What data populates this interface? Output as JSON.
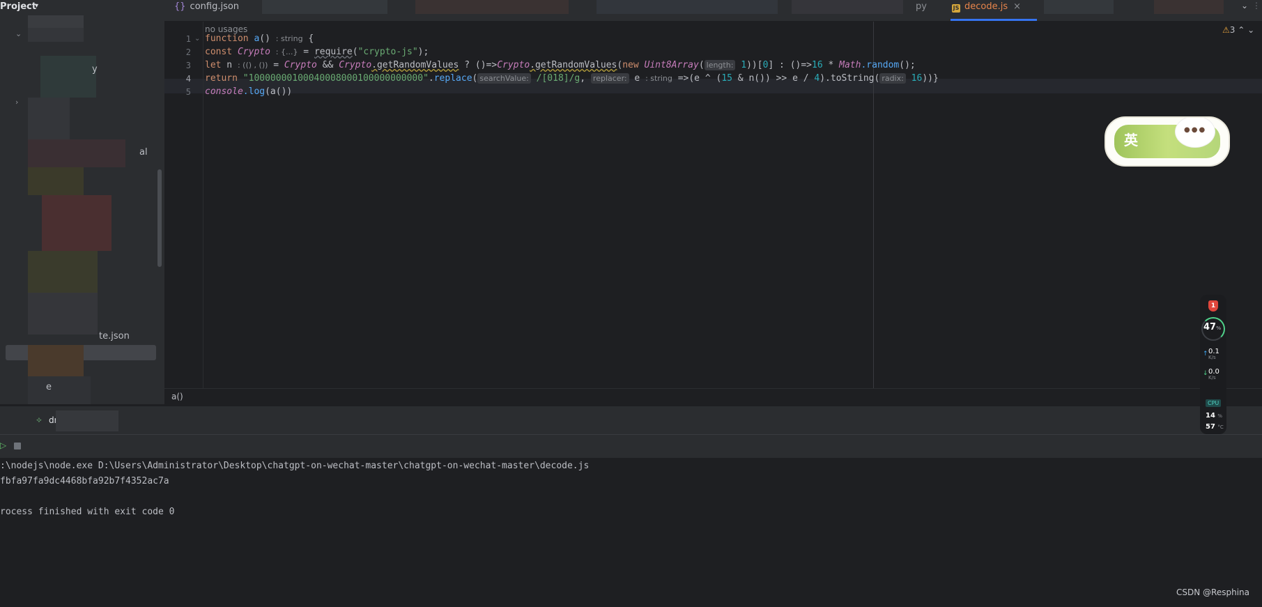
{
  "sidebar": {
    "title": "Project",
    "visible_fragments": [
      "y",
      "al",
      "te.json",
      "e",
      "dr"
    ]
  },
  "tabs": {
    "items": [
      {
        "label": "config.json",
        "icon": "json-file-icon"
      },
      {
        "label": "py",
        "icon": "python-file-icon"
      },
      {
        "label": "decode.js",
        "icon": "js-file-icon",
        "active": true
      }
    ],
    "close_glyph": "×"
  },
  "editor": {
    "no_usages": "no usages",
    "warnings_count": "3",
    "line_numbers": [
      "1",
      "2",
      "3",
      "4",
      "5"
    ],
    "breadcrumb": "a()",
    "line1": {
      "kw": "function",
      "name": "a",
      "parens": "()",
      "hint": ": string",
      "brace": "{"
    },
    "line2": {
      "kw": "const",
      "var": "Crypto",
      "hint": ": {...}",
      "eq": " = ",
      "fn": "require",
      "open": "(",
      "str": "\"crypto-js\"",
      "close": ");"
    },
    "line3": {
      "kw": "let",
      "var": " n",
      "hint": ": (() , ())",
      "eq": " = ",
      "c1": "Crypto",
      "and": " && ",
      "c2": "Crypto",
      "m1": ".getRandomValues",
      "tern": " ? ()=>",
      "c3": "Crypto",
      "m2": ".getRandomValues",
      "p1": "(",
      "kw2": "new ",
      "cls": "Uint8Array",
      "p2": "(",
      "hint_len": "length:",
      "n1": "1",
      "p3": "))[",
      "n0": "0",
      "p4": "] : ()=>",
      "n16": "16",
      "mul": " * ",
      "math": "Math",
      "rand": ".random",
      "end": "();"
    },
    "line4": {
      "kw": "return",
      "str": "\"10000000100040008000100000000000\"",
      "dot": ".",
      "fn": "replace",
      "p1": "(",
      "hint_sv": "searchValue:",
      "regex": "/[018]/g",
      "comma": ", ",
      "hint_rep": "replacer:",
      "e": " e",
      "hint_str": ": string",
      "arrow": " =>(e ^ (",
      "n15": "15",
      "amp": " & n()) >> e / ",
      "n4": "4",
      "ts": ").toString(",
      "hint_radix": "radix:",
      "n16": "16",
      "end": "))}"
    },
    "line5": {
      "obj": "console",
      "fn": ".log",
      "rest": "(a())"
    }
  },
  "run": {
    "tab_label": "dr",
    "command": ":\\nodejs\\node.exe D:\\Users\\Administrator\\Desktop\\chatgpt-on-wechat-master\\chatgpt-on-wechat-master\\decode.js",
    "output": "fbfa97fa9dc4468bfa92b7f4352ac7a",
    "exit": "rocess finished with exit code 0"
  },
  "ime": {
    "char": "英"
  },
  "monitor": {
    "badge": "1",
    "percent": "47",
    "percent_unit": "%",
    "up": "0.1",
    "down": "0.0",
    "speed_unit": "K/s",
    "cpu_label": "CPU",
    "cpu_usage": "14",
    "cpu_usage_unit": "%",
    "cpu_temp": "57",
    "cpu_temp_unit": "°C"
  },
  "watermark": "CSDN @Resphina",
  "colors": {
    "accent": "#3574f0",
    "keyword": "#cf8e6d",
    "function": "#56a8f5",
    "string": "#6aab73",
    "number": "#2aacb8",
    "class": "#c77dbb"
  }
}
